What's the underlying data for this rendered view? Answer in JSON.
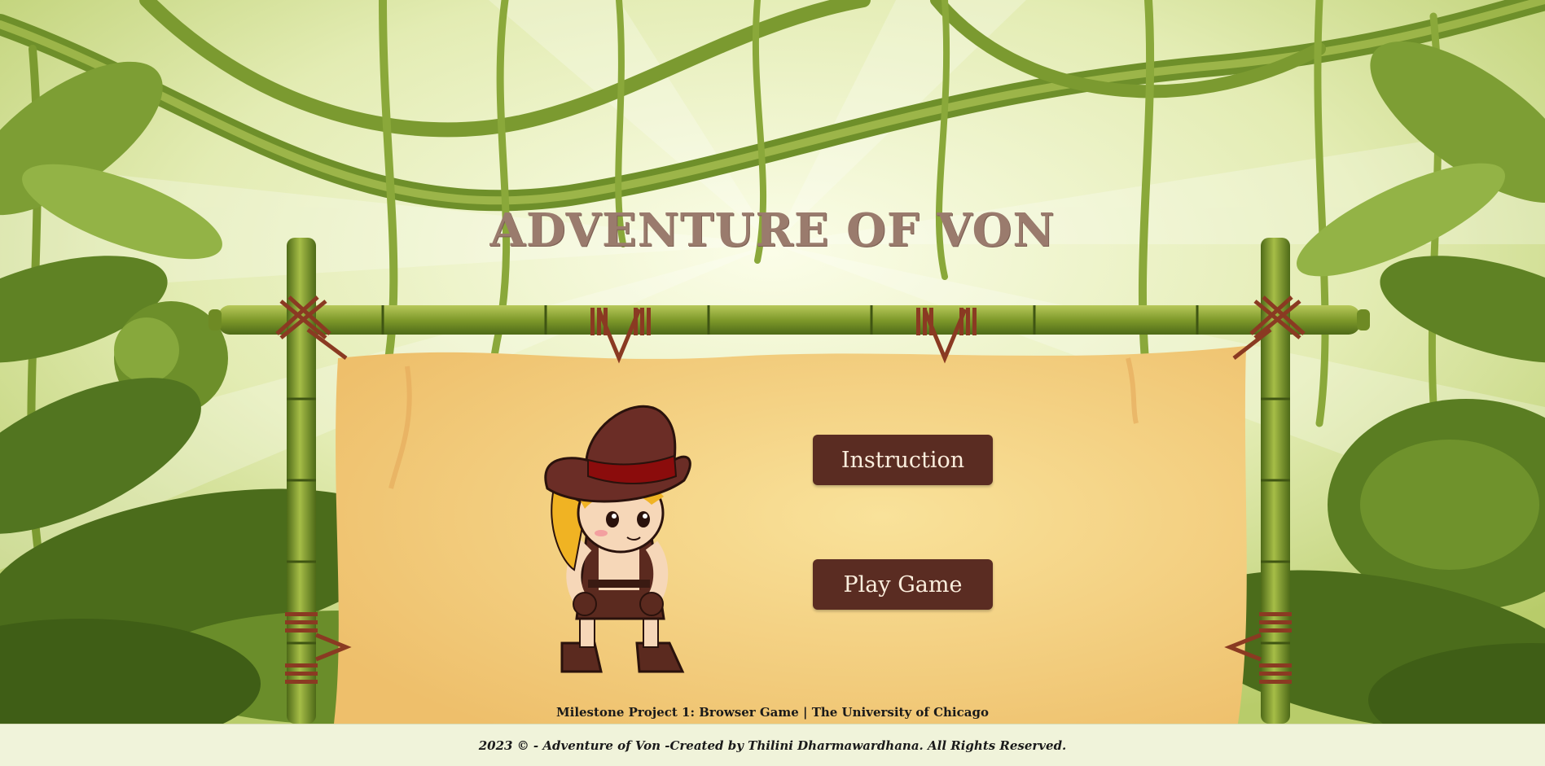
{
  "game": {
    "title": "ADVENTURE OF VON"
  },
  "menu": {
    "instruction_label": "Instruction",
    "play_label": "Play Game"
  },
  "project_line": "Milestone Project 1: Browser Game | The University of Chicago",
  "footer": {
    "copyright": "2023 © - Adventure of Von -Created by Thilini Dharmawardhana. All Rights Reserved."
  },
  "colors": {
    "button_bg": "#5a2c22",
    "button_text": "#fbeedd",
    "title": "#9a7b6d",
    "parchment": "#f3cf7f",
    "bamboo": "#8aa238",
    "footer_bg": "#f0f3da"
  },
  "icons": {
    "character": "explorer-girl-icon",
    "bamboo_frame": "bamboo-frame",
    "jungle": "jungle-foliage"
  }
}
